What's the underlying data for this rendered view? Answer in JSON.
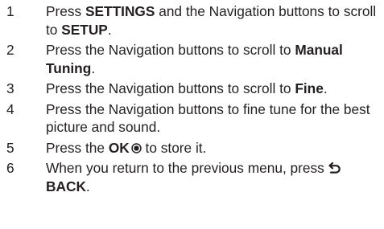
{
  "steps": [
    {
      "num": "1",
      "t1": "Press ",
      "b1": "SETTINGS",
      "t2": " and the Navigation buttons to scroll to ",
      "b2": "SETUP",
      "t3": "."
    },
    {
      "num": "2",
      "t1": "Press the Navigation buttons to scroll to ",
      "b1": "Manual Tuning",
      "t2": "."
    },
    {
      "num": "3",
      "t1": "Press the Navigation buttons to scroll to ",
      "b1": "Fine",
      "t2": "."
    },
    {
      "num": "4",
      "t1": "Press the Navigation buttons to fine tune for the best picture and sound."
    },
    {
      "num": "5",
      "t1": "Press the ",
      "b1": "OK",
      "t2": " to store it."
    },
    {
      "num": "6",
      "t1": "When you return to the previous menu, press ",
      "b1": "BACK",
      "t2": "."
    }
  ],
  "icons": {
    "ok": "ok-button-icon",
    "back": "back-arrow-icon"
  }
}
